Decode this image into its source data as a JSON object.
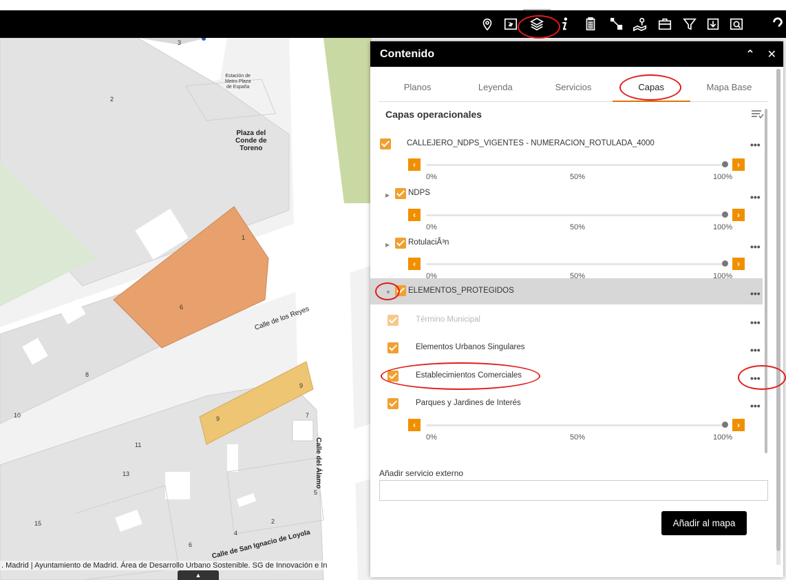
{
  "toolbar": {
    "tools": [
      {
        "name": "location-pin-icon"
      },
      {
        "name": "map-overview-icon"
      },
      {
        "name": "layers-icon"
      },
      {
        "name": "info-icon"
      },
      {
        "name": "clipboard-icon"
      },
      {
        "name": "measure-icon"
      },
      {
        "name": "print-map-icon"
      },
      {
        "name": "briefcase-icon"
      },
      {
        "name": "filter-icon"
      },
      {
        "name": "download-icon"
      },
      {
        "name": "zoom-search-icon"
      },
      {
        "name": "help-icon"
      }
    ]
  },
  "map": {
    "labels": {
      "station": [
        "Estación de",
        "Metro Plaza",
        "de España"
      ],
      "plaza": [
        "Plaza del",
        "Conde de",
        "Toreno"
      ],
      "calle_reyes": "Calle de los Reyes",
      "calle_alamo": "Calle del Álamo",
      "calle_loyola": "Calle de San Ignacio de Loyola"
    },
    "numbers": [
      "3",
      "2",
      "1",
      "6",
      "8",
      "10",
      "9",
      "9",
      "7",
      "11",
      "13",
      "15",
      "4",
      "6",
      "2",
      "5"
    ],
    "attribution": ". Madrid | Ayuntamiento de Madrid. Área de Desarrollo Urbano Sostenible. SG de Innovación e In",
    "colors": {
      "building_orange": "#e8a06c",
      "building_yellow": "#edc573",
      "park_green": "#dbe8d3",
      "plaza_olive": "#c9d9a3"
    }
  },
  "panel": {
    "title": "Contenido",
    "collapse_glyph": "≈",
    "close_glyph": "✕",
    "tabs": [
      {
        "label": "Planos",
        "active": false
      },
      {
        "label": "Leyenda",
        "active": false
      },
      {
        "label": "Servicios",
        "active": false
      },
      {
        "label": "Capas",
        "active": true
      },
      {
        "label": "Mapa Base",
        "active": false
      }
    ],
    "layers_title": "Capas operacionales",
    "slider_ticks": {
      "min": "0%",
      "mid": "50%",
      "max": "100%"
    },
    "layers": [
      {
        "label": "CALLEJERO_NDPS_VIGENTES - NUMERACION_ROTULADA_4000",
        "opacity_pct": 100
      },
      {
        "label": "NDPS",
        "opacity_pct": 100
      },
      {
        "label": "RotulaciÃ³n",
        "opacity_pct": 100
      },
      {
        "label": "ELEMENTOS_PROTEGIDOS",
        "expanded": true
      },
      {
        "label": "Término Municipal",
        "disabled": true
      },
      {
        "label": "Elementos Urbanos Singulares"
      },
      {
        "label": "Establecimientos Comerciales"
      },
      {
        "label": "Parques y Jardines de Interés",
        "opacity_pct": 100
      }
    ],
    "menu_dots": "•••",
    "external": {
      "label": "Añadir servicio externo",
      "value": "",
      "button": "Añadir al mapa"
    },
    "accent_color": "#f09000"
  }
}
